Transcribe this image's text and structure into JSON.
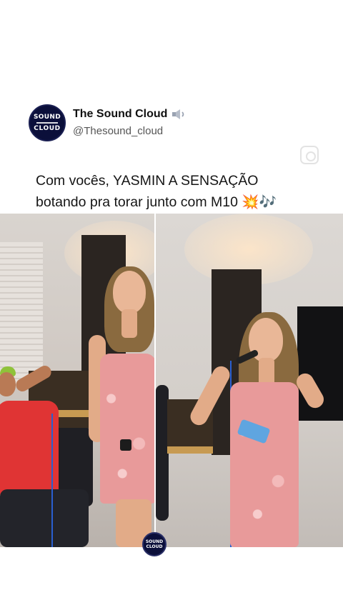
{
  "post": {
    "account_name": "The Sound Cloud",
    "account_handle": "@Thesound_cloud",
    "verified_icon": "speaker-low-volume-icon",
    "caption_lines": [
      "Com vocês, YASMIN A SENSAÇÃO",
      "botando pra torar junto com M10 💥🎶"
    ]
  },
  "avatar": {
    "line1": "SOUND",
    "line2": "CLOUD"
  },
  "watermark": {
    "line1": "SOUND",
    "line2": "CLOUD"
  },
  "colors": {
    "brand_navy": "#0b0f3a",
    "dress_pink": "#e89a9a",
    "shirt_red": "#e03434"
  }
}
